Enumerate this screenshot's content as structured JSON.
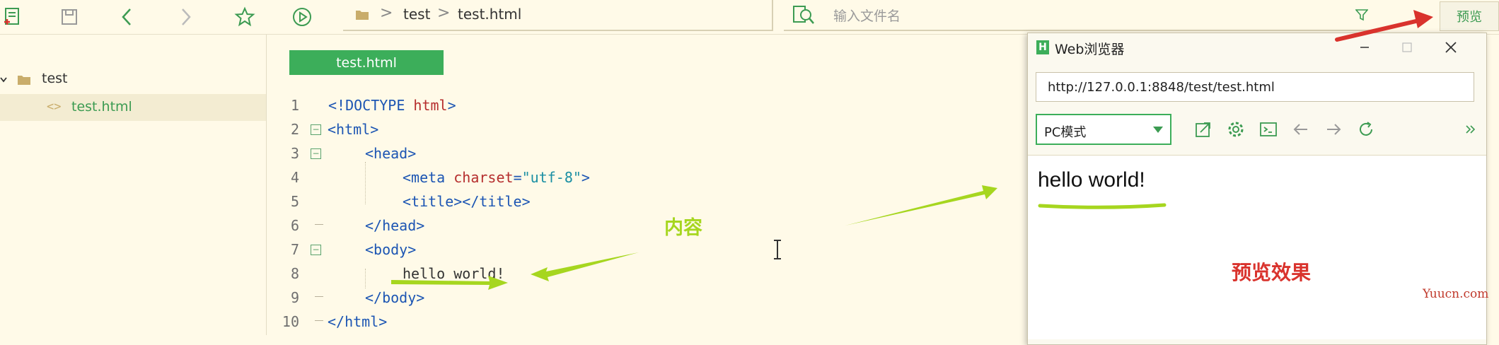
{
  "toolbar": {
    "icons": [
      "new-file-icon",
      "save-icon",
      "back-icon",
      "forward-icon",
      "favorite-icon",
      "run-icon"
    ],
    "breadcrumb": [
      "test",
      "test.html"
    ],
    "search_placeholder": "输入文件名",
    "preview_label": "预览"
  },
  "sidebar": {
    "items": [
      {
        "label": "test",
        "type": "folder"
      },
      {
        "label": "test.html",
        "type": "file"
      }
    ]
  },
  "editor": {
    "tab": "test.html",
    "lines": [
      {
        "num": "1",
        "html": "&lt;!DOCTYPE html&gt;"
      },
      {
        "num": "2"
      },
      {
        "num": "3"
      },
      {
        "num": "4"
      },
      {
        "num": "5"
      },
      {
        "num": "6"
      },
      {
        "num": "7"
      },
      {
        "num": "8"
      },
      {
        "num": "9"
      },
      {
        "num": "10"
      }
    ]
  },
  "browser": {
    "title": "Web浏览器",
    "url": "http://127.0.0.1:8848/test/test.html",
    "mode": "PC模式",
    "content_text": "hello world!"
  },
  "annotations": {
    "content_label": "内容",
    "preview_label": "预览效果"
  },
  "watermark": "Yuucn.com",
  "colors": {
    "accent_green": "#3cae5a",
    "annotation_green": "#a6d61f",
    "annotation_red": "#d9332d"
  }
}
